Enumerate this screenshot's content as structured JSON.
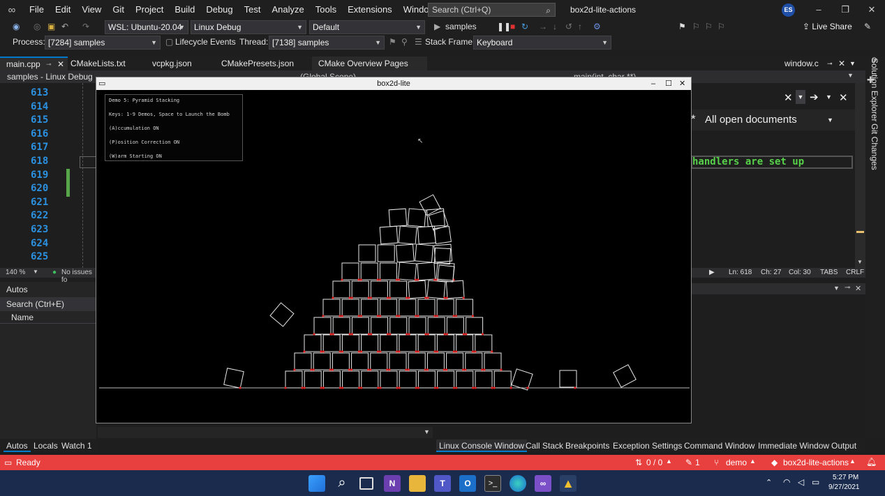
{
  "menu": {
    "items": [
      "File",
      "Edit",
      "View",
      "Git",
      "Project",
      "Build",
      "Debug",
      "Test",
      "Analyze",
      "Tools",
      "Extensions",
      "Window",
      "Help"
    ],
    "search_placeholder": "Search (Ctrl+Q)",
    "solution_name": "box2d-lite-actions",
    "avatar_initials": "ES"
  },
  "toolbar": {
    "target_system": "WSL: Ubuntu-20.04",
    "configuration": "Linux Debug",
    "build_preset": "Default",
    "run_target": "samples",
    "live_share": "Live Share"
  },
  "debugbar": {
    "process_label": "Process:",
    "process_value": "[7284] samples",
    "lifecycle_label": "Lifecycle Events",
    "thread_label": "Thread:",
    "thread_value": "[7138] samples",
    "stack_label": "Stack Frame:",
    "stack_value": "Keyboard"
  },
  "doc_tabs": [
    "main.cpp",
    "CMakeLists.txt",
    "vcpkg.json",
    "CMakePresets.json",
    "CMake Overview Pages",
    "window.c"
  ],
  "nav": {
    "project": "samples - Linux Debug",
    "scope": "(Global Scope)",
    "function": "main(int, char **)"
  },
  "editor": {
    "line_numbers": [
      "613",
      "614",
      "615",
      "616",
      "617",
      "618",
      "619",
      "620",
      "621",
      "622",
      "623",
      "624",
      "625"
    ],
    "zoom": "140 %",
    "issues": "No issues fo",
    "code_fragment": "handlers are set up",
    "position": {
      "ln": "Ln: 618",
      "ch": "Ch: 27",
      "col": "Col: 30",
      "tabs": "TABS",
      "eol": "CRLF"
    }
  },
  "solution_panel": {
    "title": "All open documents"
  },
  "autos": {
    "title": "Autos",
    "search": "Search (Ctrl+E)",
    "column": "Name"
  },
  "bottom_tabs_left": [
    "Autos",
    "Locals",
    "Watch 1"
  ],
  "bottom_tabs_right": [
    "Linux Console Window",
    "Call Stack",
    "Breakpoints",
    "Exception Settings",
    "Command Window",
    "Immediate Window",
    "Output"
  ],
  "side_rail": [
    "Solution Explorer",
    "Git Changes"
  ],
  "statusbar": {
    "state": "Ready",
    "changes": "0 / 0",
    "commits": "1",
    "branch": "demo",
    "repo": "box2d-lite-actions"
  },
  "taskbar": {
    "time": "5:27 PM",
    "date": "9/27/2021"
  },
  "app_window": {
    "title": "box2d-lite",
    "info_lines": [
      "Demo 5: Pyramid Stacking",
      "Keys: 1-9 Demos, Space to Launch the Bomb",
      "(A)ccumulation ON",
      "(P)osition Correction ON",
      "(W)arm Starting ON"
    ]
  },
  "colors": {
    "status_bar": "#e8403f",
    "accent": "#007acc",
    "line_number": "#2b91e0",
    "contact_point": "#e02020"
  }
}
